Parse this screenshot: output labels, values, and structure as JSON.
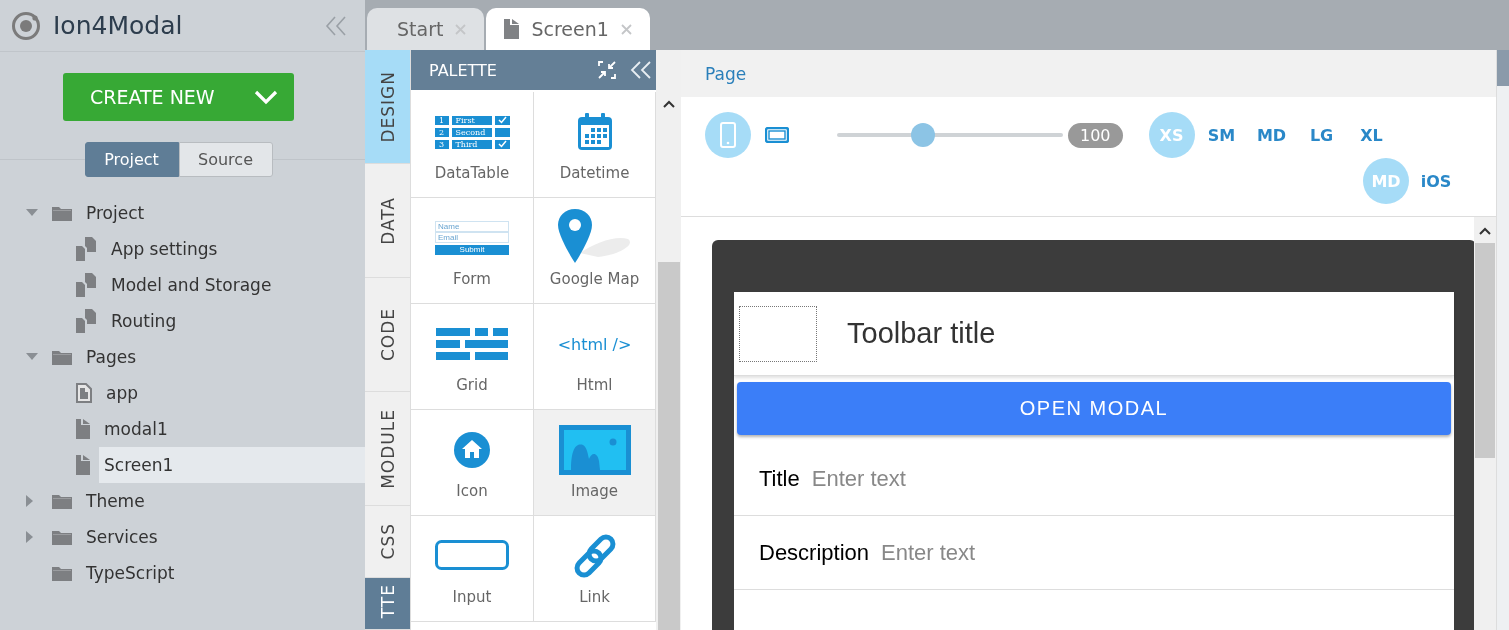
{
  "app": {
    "title": "Ion4Modal"
  },
  "create_button": {
    "label": "CREATE NEW"
  },
  "view_toggle": [
    {
      "label": "Project",
      "selected": true
    },
    {
      "label": "Source",
      "selected": false
    }
  ],
  "tree": [
    {
      "label": "Project",
      "kind": "folder",
      "expanded": true,
      "selected": false,
      "children": [
        {
          "label": "App settings",
          "kind": "settings",
          "selected": false
        },
        {
          "label": "Model and Storage",
          "kind": "settings",
          "selected": false
        },
        {
          "label": "Routing",
          "kind": "settings",
          "selected": false
        }
      ]
    },
    {
      "label": "Pages",
      "kind": "folder",
      "expanded": true,
      "selected": false,
      "children": [
        {
          "label": "app",
          "kind": "app-page",
          "selected": false
        },
        {
          "label": "modal1",
          "kind": "page",
          "selected": false
        },
        {
          "label": "Screen1",
          "kind": "page",
          "selected": true
        }
      ]
    },
    {
      "label": "Theme",
      "kind": "folder",
      "expanded": false,
      "selected": false
    },
    {
      "label": "Services",
      "kind": "folder",
      "expanded": false,
      "selected": false
    },
    {
      "label": "TypeScript",
      "kind": "folder",
      "selected": false
    }
  ],
  "editor_tabs": [
    {
      "label": "Start",
      "kind": "start",
      "selected": false
    },
    {
      "label": "Screen1",
      "kind": "page",
      "selected": true
    }
  ],
  "side_tabs": [
    {
      "label": "DESIGN",
      "kind": "section",
      "selected": true
    },
    {
      "label": "DATA",
      "kind": "section",
      "selected": false
    },
    {
      "label": "CODE",
      "kind": "section",
      "selected": false
    },
    {
      "label": "MODULE",
      "kind": "section",
      "selected": false
    },
    {
      "label": "CSS",
      "kind": "section",
      "selected": false
    },
    {
      "label": "TTE",
      "kind": "panel",
      "selected": true
    }
  ],
  "palette": {
    "title": "PALETTE",
    "items": [
      {
        "label": "DataTable",
        "kind": "datatable",
        "selected": false,
        "rows": [
          {
            "number": "1",
            "label": "First",
            "checked": true
          },
          {
            "number": "2",
            "label": "Second",
            "checked": false
          },
          {
            "number": "3",
            "label": "Third",
            "checked": true
          }
        ]
      },
      {
        "label": "Datetime",
        "kind": "calendar",
        "selected": false
      },
      {
        "label": "Form",
        "kind": "form",
        "selected": false,
        "fields": [
          "Name",
          "Email"
        ],
        "submit": "Submit"
      },
      {
        "label": "Google Map",
        "kind": "map",
        "selected": false
      },
      {
        "label": "Grid",
        "kind": "grid",
        "selected": false
      },
      {
        "label": "Html",
        "kind": "html",
        "selected": false,
        "glyph": "<html />"
      },
      {
        "label": "Icon",
        "kind": "icon",
        "selected": false
      },
      {
        "label": "Image",
        "kind": "image",
        "selected": true
      },
      {
        "label": "Input",
        "kind": "input",
        "selected": false
      },
      {
        "label": "Link",
        "kind": "link",
        "selected": false
      }
    ]
  },
  "designer": {
    "breadcrumb": "Page",
    "devices": [
      {
        "kind": "phone",
        "selected": true
      },
      {
        "kind": "tablet",
        "selected": false
      }
    ],
    "zoom": {
      "level": 0.38,
      "reading": "100"
    },
    "sizes": [
      {
        "label": "XS",
        "selected": true
      },
      {
        "label": "SM",
        "selected": false
      },
      {
        "label": "MD",
        "selected": false
      },
      {
        "label": "LG",
        "selected": false
      },
      {
        "label": "XL",
        "selected": false
      }
    ],
    "platforms": [
      {
        "label": "MD",
        "selected": true
      },
      {
        "label": "iOS",
        "selected": false
      }
    ]
  },
  "preview": {
    "toolbar_title": "Toolbar title",
    "button": "OPEN MODAL",
    "fields": [
      {
        "label": "Title",
        "placeholder": "Enter text"
      },
      {
        "label": "Description",
        "placeholder": "Enter text"
      }
    ]
  }
}
